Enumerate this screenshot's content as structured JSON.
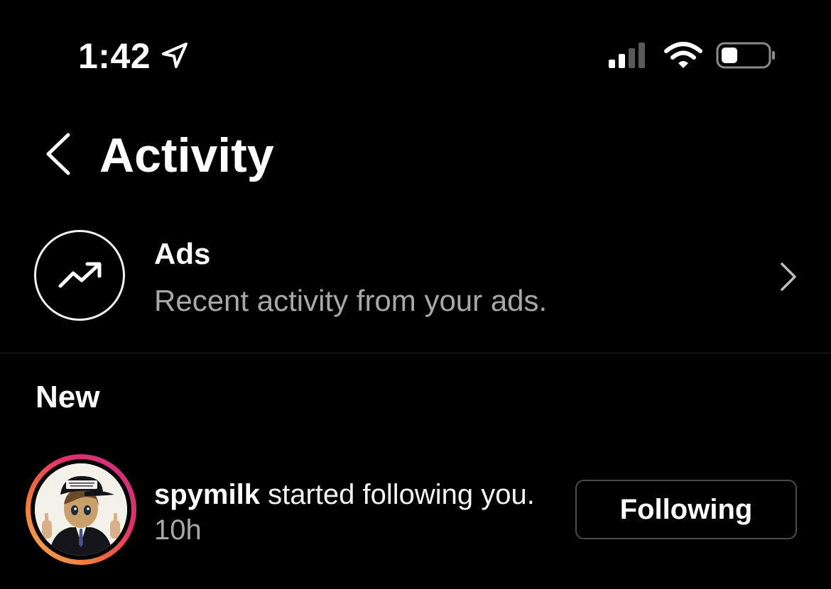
{
  "status_bar": {
    "time": "1:42",
    "location_icon": "location-arrow-icon",
    "signal_icon": "cellular-signal-icon",
    "wifi_icon": "wifi-icon",
    "battery_icon": "battery-icon"
  },
  "header": {
    "back_icon": "chevron-left-icon",
    "title": "Activity"
  },
  "ads": {
    "icon": "trending-up-icon",
    "title": "Ads",
    "subtitle": "Recent activity from your ads.",
    "chevron_icon": "chevron-right-icon"
  },
  "sections": {
    "new_label": "New"
  },
  "notifications": [
    {
      "username": "spymilk",
      "action": " started following you.",
      "time": "10h",
      "button_label": "Following"
    }
  ],
  "colors": {
    "background": "#000000",
    "text_primary": "#ffffff",
    "text_secondary": "#a8a8a8",
    "divider": "#262626",
    "ring_gradient": [
      "#f8b653",
      "#f06e3a",
      "#e1306c",
      "#c13584"
    ]
  }
}
